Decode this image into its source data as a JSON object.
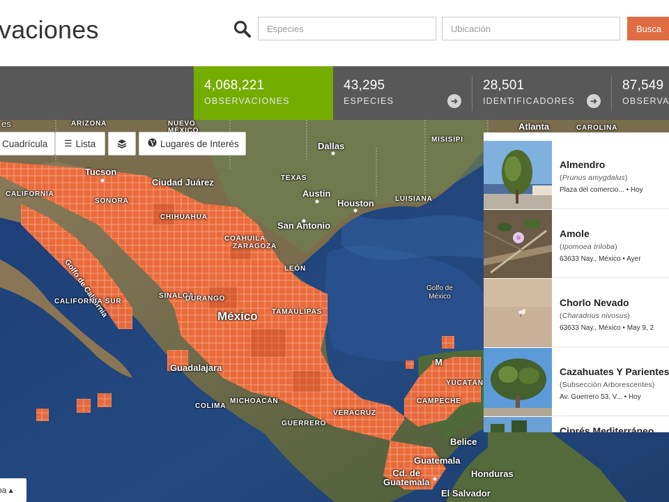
{
  "header": {
    "title": "vaciones",
    "search": {
      "species_placeholder": "Especies",
      "location_placeholder": "Ubicación",
      "button_label": "Busca"
    }
  },
  "stats": [
    {
      "number": "4,068,221",
      "label": "OBSERVACIONES",
      "active": true
    },
    {
      "number": "43,295",
      "label": "ESPECIES"
    },
    {
      "number": "28,501",
      "label": "IDENTIFICADORES"
    },
    {
      "number": "87,549",
      "label": "OBSERVAI"
    }
  ],
  "map": {
    "toolbar": {
      "grid_label": "Cuadrícula",
      "list_label": "Lista",
      "places_label": "Lugares de Interés"
    },
    "map_type_label": "pa ▴",
    "labels": {
      "arizona": "ARIZONA",
      "nuevo": "NUEVO",
      "mexico_state": "MÉXICO",
      "dallas": "Dallas",
      "misisipi": "MISISIPI",
      "atlanta": "Atlanta",
      "carolina": "CAROLINA",
      "tucson": "Tucson",
      "juarez": "Ciudad Juárez",
      "texas": "TEXAS",
      "austin": "Austin",
      "houston": "Houston",
      "luisiana": "LUISIANA",
      "san_antonio": "San Antonio",
      "sonora": "SONORA",
      "chihuahua": "CHIHUAHUA",
      "coahuila": "COAHUILA",
      "zaragoza": "ZARAGOZA",
      "golfo_california": "Golfo de California",
      "leon": "LEÓN",
      "golfo_mexico": "Golfo de\nMéxico",
      "baja_sur": "CALIFORNIA SUR",
      "sinaloa": "SINALOA",
      "durango": "DURANGO",
      "tamaulipas": "TAMAULIPAS",
      "mexico": "México",
      "guadalajara": "Guadalajara",
      "colima": "COLIMA",
      "michoacan": "MICHOACÁN",
      "guerrero": "GUERRERO",
      "veracruz": "VERACRUZ",
      "campeche": "CAMPECHE",
      "yucatan": "YUCATÁN",
      "belice": "Belice",
      "guatemala": "Guatemala",
      "honduras": "Honduras",
      "ciudad_guatemala": "Cd. de\nGuatemala",
      "el_salvador": "El Salvador",
      "es": "es",
      "baja": "CALIFORNIA",
      "m_label": "M"
    }
  },
  "observations": [
    {
      "common": "Almendro",
      "scientific": "Prunus amygdalus",
      "sci_italic": true,
      "place": "Plaza del comercio...",
      "date": "Hoy"
    },
    {
      "common": "Amole",
      "scientific": "Ipomoea triloba",
      "sci_italic": true,
      "place": "63633 Nay., México",
      "date": "Ayer"
    },
    {
      "common": "Chorlo Nevado",
      "scientific": "Charadrius nivosus",
      "sci_italic": true,
      "place": "63633 Nay., México",
      "date": "May 9, 2"
    },
    {
      "common": "Cazahuates Y Parientes",
      "scientific": "Subsección Arborescentes",
      "sci_italic": false,
      "place": "Av. Guerrero 53, V...",
      "date": "Hoy"
    },
    {
      "common": "Ciprés Mediterráneo",
      "scientific": "",
      "sci_italic": false,
      "place": "",
      "date": ""
    }
  ],
  "colors": {
    "accent_green": "#74ac00",
    "stats_bar": "#585858",
    "search_button": "#e06c43",
    "grid_orange": "#f26b3a"
  }
}
